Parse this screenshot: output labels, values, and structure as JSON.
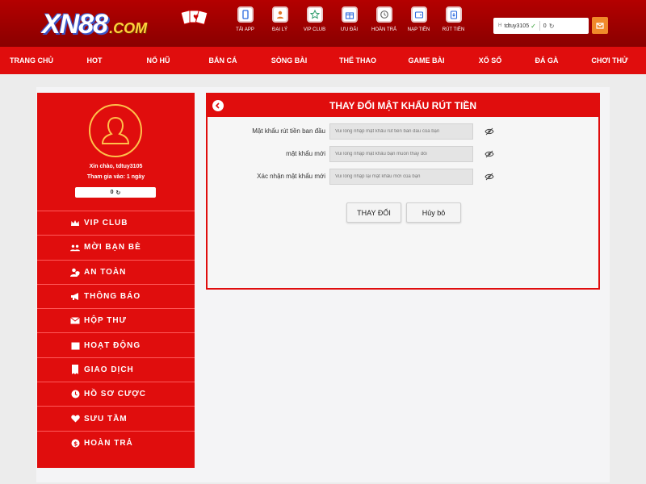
{
  "header": {
    "logo_main": "XN88",
    "logo_suffix": ".COM",
    "top_icons": [
      {
        "label": "TẢI APP",
        "icon": "phone-icon"
      },
      {
        "label": "ĐẠI LÝ",
        "icon": "agent-icon"
      },
      {
        "label": "VIP CLUB",
        "icon": "star-icon"
      },
      {
        "label": "ƯU ĐÃI",
        "icon": "gift-icon"
      },
      {
        "label": "HOÀN TRẢ",
        "icon": "refund-icon"
      },
      {
        "label": "NẠP TIỀN",
        "icon": "wallet-icon"
      },
      {
        "label": "RÚT TIỀN",
        "icon": "withdraw-icon"
      }
    ],
    "username": "tdtuy3105",
    "balance": "0"
  },
  "nav": {
    "items": [
      "TRANG CHỦ",
      "HOT",
      "NỔ HŨ",
      "BẮN CÁ",
      "SÒNG BÀI",
      "THỂ THAO",
      "GAME BÀI",
      "XỔ SỐ",
      "ĐÁ GÀ",
      "CHƠI THỬ"
    ]
  },
  "profile": {
    "greeting": "Xin chào, tdtuy3105",
    "joined": "Tham gia vào: 1 ngày",
    "balance": "0"
  },
  "sidebar": {
    "items": [
      {
        "label": "VIP CLUB",
        "icon": "crown-icon"
      },
      {
        "label": "MỜI BẠN BÈ",
        "icon": "users-icon"
      },
      {
        "label": "AN TOÀN",
        "icon": "user-shield-icon"
      },
      {
        "label": "THÔNG BÁO",
        "icon": "megaphone-icon"
      },
      {
        "label": "HỘP THƯ",
        "icon": "envelope-icon"
      },
      {
        "label": "HOẠT ĐỘNG",
        "icon": "calendar-icon"
      },
      {
        "label": "GIAO DỊCH",
        "icon": "receipt-icon"
      },
      {
        "label": "HỒ SƠ CƯỢC",
        "icon": "history-icon"
      },
      {
        "label": "SƯU TẦM",
        "icon": "heart-icon"
      },
      {
        "label": "HOÀN TRẢ",
        "icon": "refund-circle-icon"
      }
    ]
  },
  "panel": {
    "title": "THAY ĐỔI MẬT KHẨU RÚT TIỀN",
    "fields": [
      {
        "label": "Mật khẩu rút tiền ban đầu",
        "placeholder": "Vui lòng nhập mật khẩu rút tiền ban đầu của bạn"
      },
      {
        "label": "mật khẩu mới",
        "placeholder": "Vui lòng nhập mật khẩu bạn muốn thay đổi"
      },
      {
        "label": "Xác nhận mật khẩu mới",
        "placeholder": "Vui lòng nhập lại mật khẩu mới của bạn"
      }
    ],
    "submit_label": "THAY ĐỔI",
    "cancel_label": "Hủy bỏ"
  },
  "colors": {
    "brand_red": "#e00d0d",
    "dark_red": "#8a0000",
    "accent_gold": "#ffc04a"
  }
}
